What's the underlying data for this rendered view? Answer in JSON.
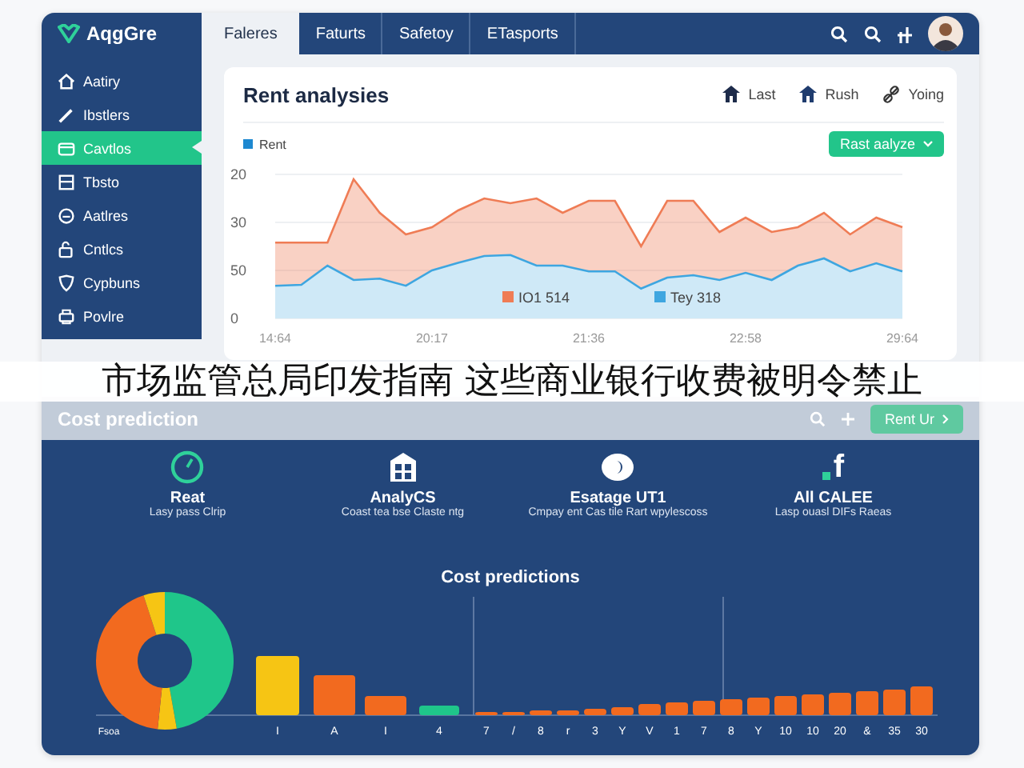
{
  "app": {
    "logo": "AqgGre"
  },
  "tabs": [
    {
      "label": "Faleres",
      "selected": true
    },
    {
      "label": "Faturts",
      "selected": false
    },
    {
      "label": "Safetoy",
      "selected": false
    },
    {
      "label": "ETasports",
      "selected": false
    }
  ],
  "sidebar": {
    "items": [
      {
        "label": "Aatiry",
        "selected": false
      },
      {
        "label": "Ibstlers",
        "selected": false
      },
      {
        "label": "Cavtlos",
        "selected": true
      },
      {
        "label": "Tbsto",
        "selected": false
      },
      {
        "label": "Aatlres",
        "selected": false
      },
      {
        "label": "Cntlcs",
        "selected": false
      },
      {
        "label": "Cypbuns",
        "selected": false
      },
      {
        "label": "Povlre",
        "selected": false
      }
    ]
  },
  "rent_card": {
    "title": "Rent analysies",
    "actions": [
      "Last",
      "Rush",
      "Yoing"
    ],
    "legend": "Rent",
    "button": "Rast aalyze",
    "y_labels": [
      "20",
      "30",
      "50",
      "0"
    ],
    "x_labels": [
      "14:64",
      "20:17",
      "21:36",
      "22:58",
      "29:64"
    ],
    "series": [
      {
        "name": "IO1 514",
        "color": "#ef7c55"
      },
      {
        "name": "Tey 318",
        "color": "#3ea6e0"
      }
    ]
  },
  "banner": {
    "text": "市场监管总局印发指南 这些商业银行收费被明令禁止"
  },
  "cost_panel": {
    "title": "Cost prediction",
    "button": "Rent Ur",
    "features": [
      {
        "title": "Reat",
        "description": "Lasy pass Clrip"
      },
      {
        "title": "AnalyCS",
        "description": "Coast tea bse Claste ntg"
      },
      {
        "title": "Esatage UT1",
        "description": "Cmpay ent Cas tile Rart wpylescoss"
      },
      {
        "title": "All CALEE",
        "description": "Lasp ouasl DIFs Raeas",
        "glyph": "f"
      }
    ],
    "chart_title": "Cost predictions",
    "donut_label": "Fsoa",
    "bar_labels": [
      "I",
      "A",
      "I",
      "4",
      "7",
      "/",
      "8",
      "r",
      "3",
      "Y",
      "V",
      "1",
      "7",
      "8",
      "Y",
      "10",
      "10",
      "20",
      "&",
      "35",
      "30"
    ]
  }
}
